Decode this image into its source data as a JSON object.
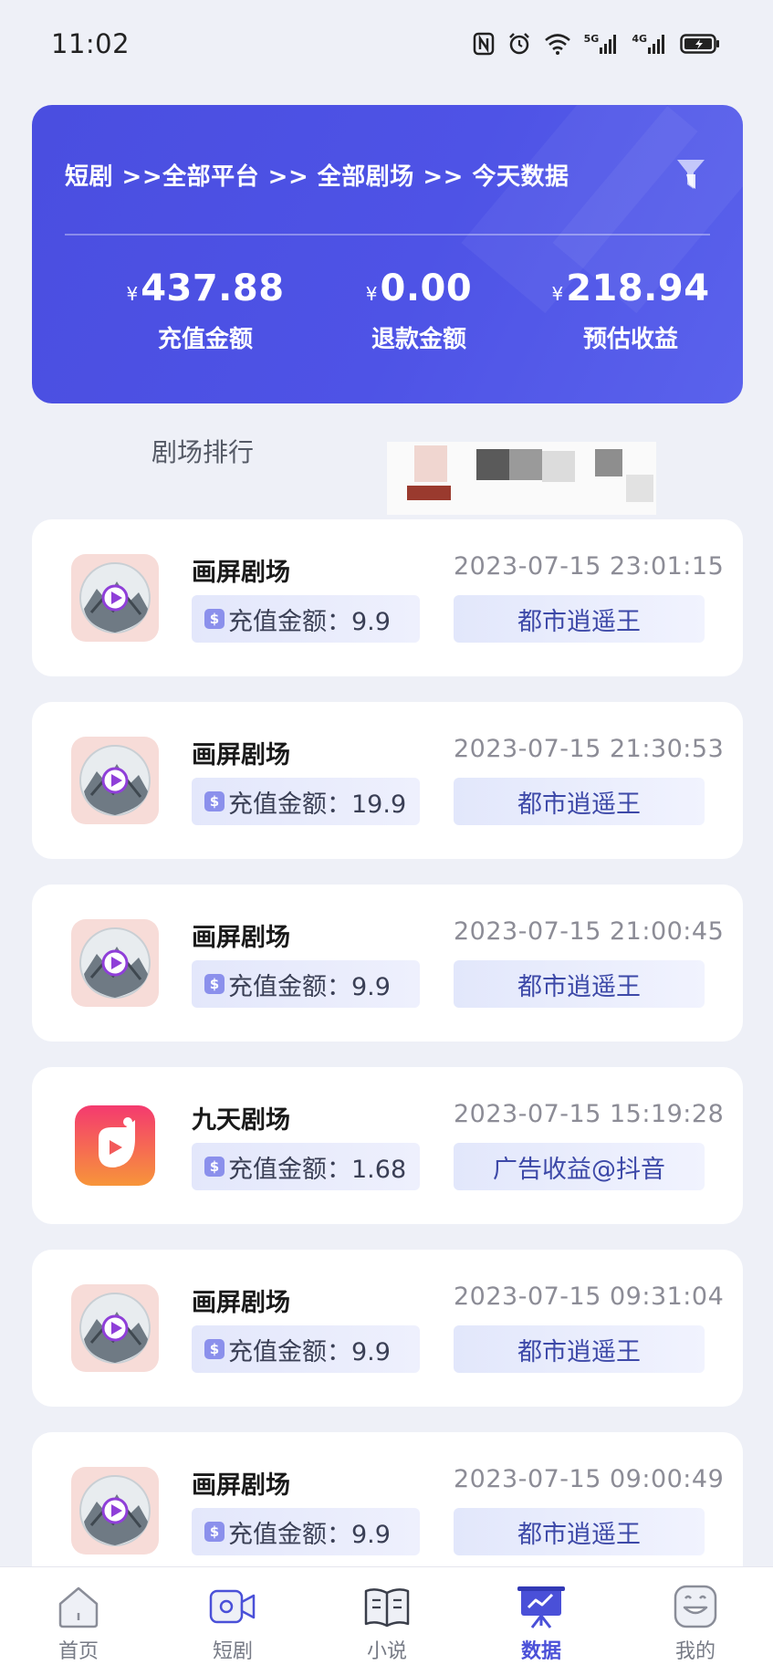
{
  "status_bar": {
    "time": "11:02",
    "signal_1": "5G",
    "signal_2": "4G"
  },
  "summary": {
    "breadcrumb": "短剧 >>全部平台 >> 全部剧场 >> 今天数据",
    "currency_symbol": "¥",
    "stats": [
      {
        "value": "437.88",
        "label": "充值金额"
      },
      {
        "value": "0.00",
        "label": "退款金额"
      },
      {
        "value": "218.94",
        "label": "预估收益"
      }
    ]
  },
  "ranking": {
    "title": "剧场排行"
  },
  "records": [
    {
      "theatre": "画屏剧场",
      "amount": "充值金额：9.9",
      "time": "2023-07-15 23:01:15",
      "tag": "都市逍遥王",
      "thumb": "landscape-play-icon"
    },
    {
      "theatre": "画屏剧场",
      "amount": "充值金额：19.9",
      "time": "2023-07-15 21:30:53",
      "tag": "都市逍遥王",
      "thumb": "landscape-play-icon"
    },
    {
      "theatre": "画屏剧场",
      "amount": "充值金额：9.9",
      "time": "2023-07-15 21:00:45",
      "tag": "都市逍遥王",
      "thumb": "landscape-play-icon"
    },
    {
      "theatre": "九天剧场",
      "amount": "充值金额：1.68",
      "time": "2023-07-15 15:19:28",
      "tag": "广告收益@抖音",
      "thumb": "jiutian-app-icon"
    },
    {
      "theatre": "画屏剧场",
      "amount": "充值金额：9.9",
      "time": "2023-07-15 09:31:04",
      "tag": "都市逍遥王",
      "thumb": "landscape-play-icon"
    },
    {
      "theatre": "画屏剧场",
      "amount": "充值金额：9.9",
      "time": "2023-07-15 09:00:49",
      "tag": "都市逍遥王",
      "thumb": "landscape-play-icon"
    }
  ],
  "nav": [
    {
      "label": "首页",
      "icon": "home-icon",
      "active": false
    },
    {
      "label": "短剧",
      "icon": "video-camera-icon",
      "active": false
    },
    {
      "label": "小说",
      "icon": "book-icon",
      "active": false
    },
    {
      "label": "数据",
      "icon": "chart-board-icon",
      "active": true
    },
    {
      "label": "我的",
      "icon": "smile-face-icon",
      "active": false
    }
  ],
  "colors": {
    "accent": "#4a50d8",
    "card_bg": "#4e53e6",
    "page_bg": "#eef0f7",
    "tag_text": "#3d49a8"
  }
}
